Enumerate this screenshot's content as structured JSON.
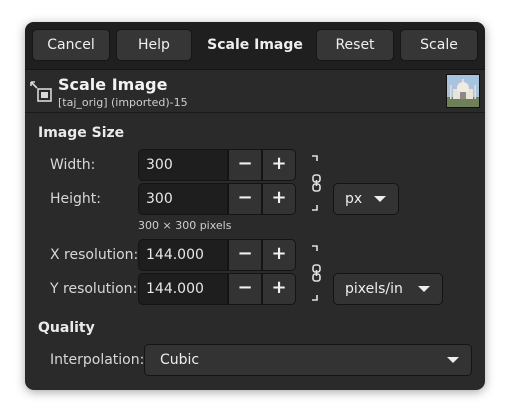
{
  "header": {
    "cancel_label": "Cancel",
    "help_label": "Help",
    "title": "Scale Image",
    "reset_label": "Reset",
    "scale_label": "Scale"
  },
  "subheader": {
    "title": "Scale Image",
    "subtitle": "[taj_orig] (imported)-15",
    "icon": "scale-image-icon",
    "thumbnail": "image-thumbnail"
  },
  "image_size": {
    "section_label": "Image Size",
    "width_label": "Width:",
    "width_value": "300",
    "height_label": "Height:",
    "height_value": "300",
    "size_info": "300 × 300 pixels",
    "unit": "px",
    "x_res_label": "X resolution:",
    "x_res_value": "144.000",
    "y_res_label": "Y resolution:",
    "y_res_value": "144.000",
    "res_unit": "pixels/in",
    "decrement_symbol": "−",
    "increment_symbol": "+"
  },
  "quality": {
    "section_label": "Quality",
    "interpolation_label": "Interpolation:",
    "interpolation_value": "Cubic"
  },
  "colors": {
    "dialog_bg": "#2a2a2a",
    "header_bg": "#1f1f1f",
    "entry_bg": "#1e1e1e",
    "button_bg": "#363636"
  }
}
